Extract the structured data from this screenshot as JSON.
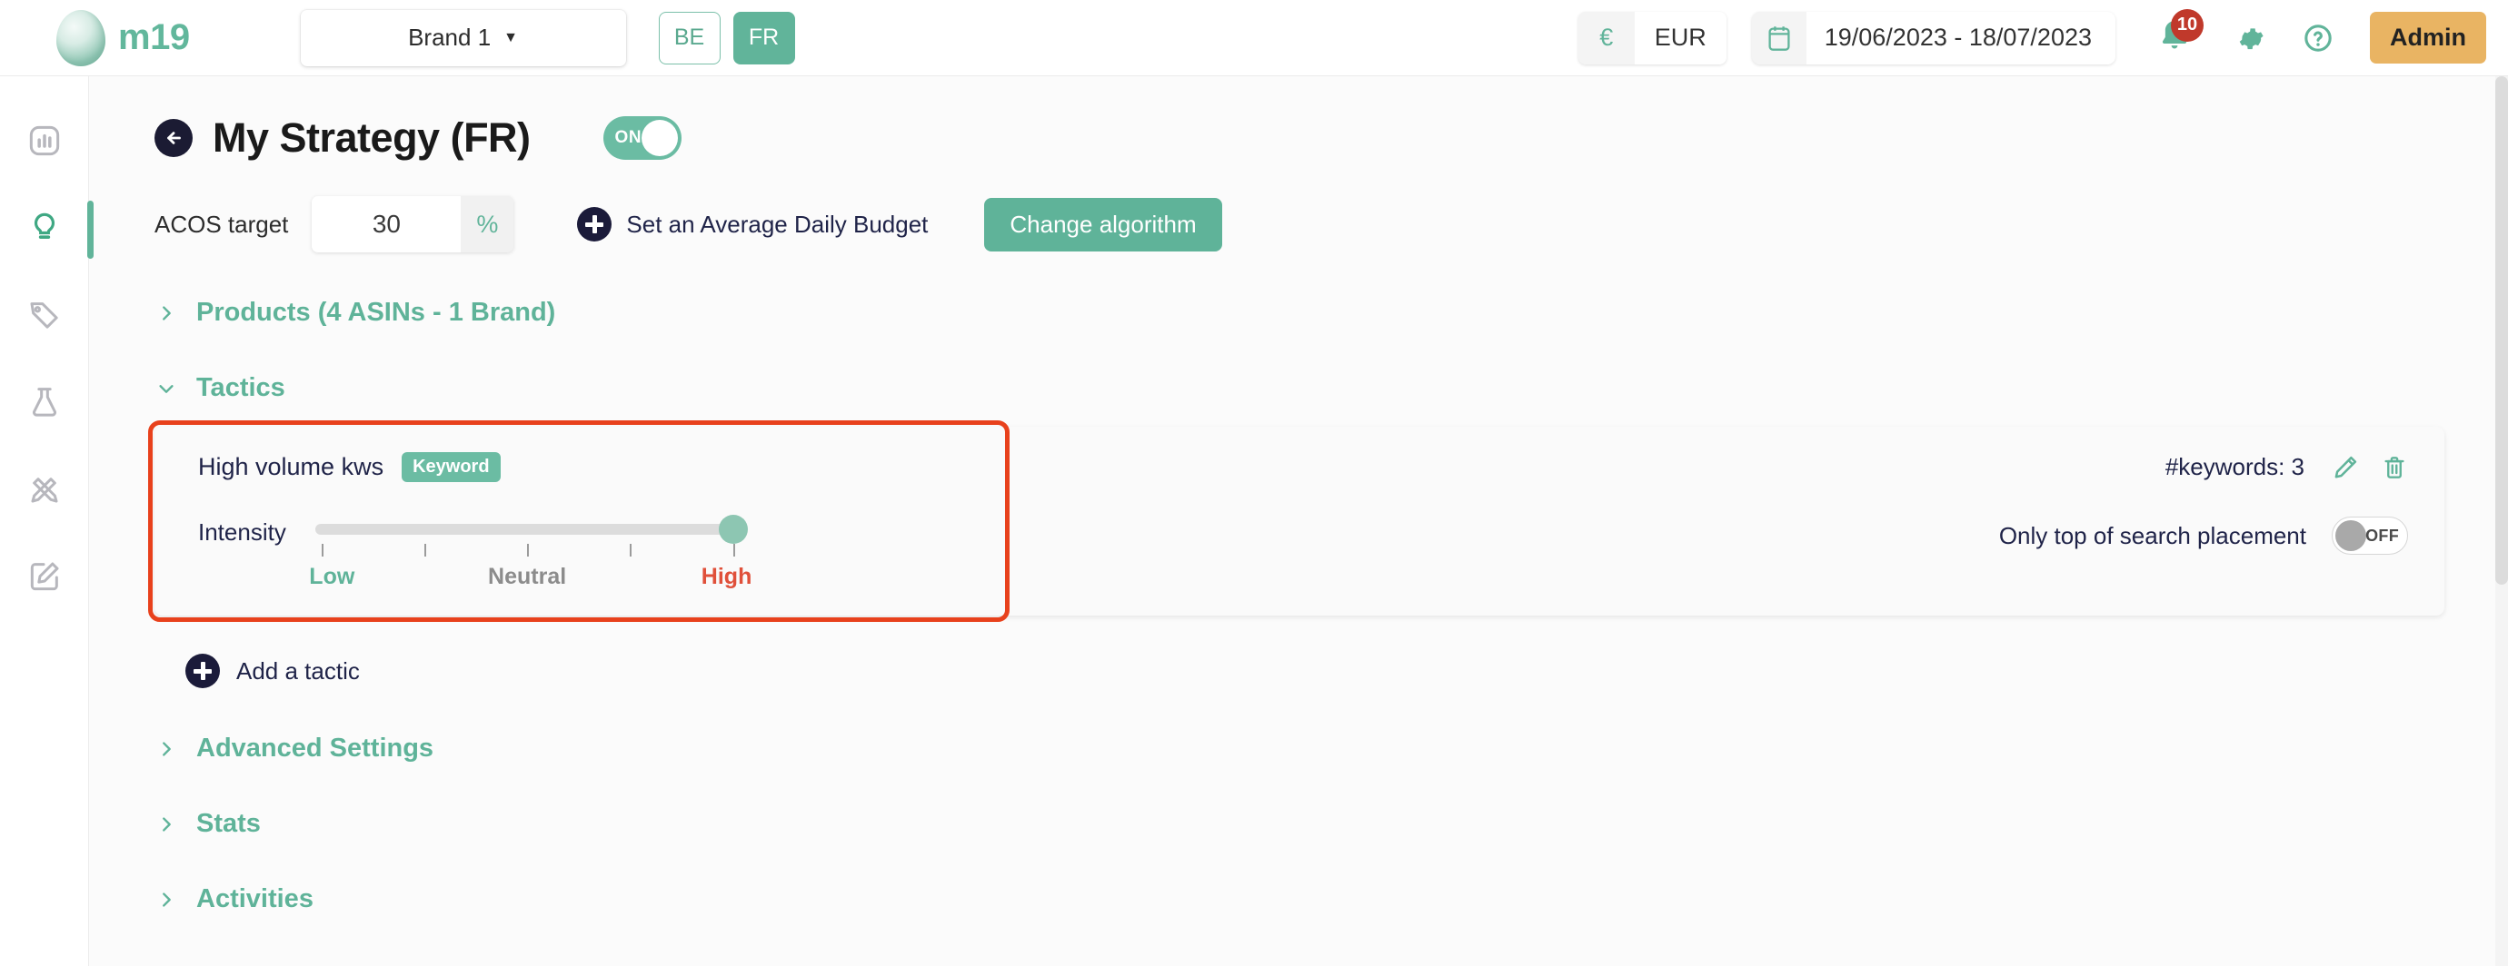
{
  "header": {
    "logo_text": "m19",
    "brand_selector": {
      "value": "Brand 1",
      "caret_icon": "chevron-down-icon"
    },
    "locales": [
      {
        "code": "BE",
        "active": false
      },
      {
        "code": "FR",
        "active": true
      }
    ],
    "currency": {
      "symbol": "€",
      "code": "EUR"
    },
    "date_range": "19/06/2023 - 18/07/2023",
    "notifications_count": "10",
    "admin_label": "Admin",
    "icons": {
      "calendar": "calendar-icon",
      "bell": "bell-icon",
      "gear": "gear-icon",
      "help": "question-circle-icon"
    }
  },
  "sidebar": {
    "items": [
      {
        "icon": "bar-chart-icon",
        "name": "dashboard",
        "active": false
      },
      {
        "icon": "lightbulb-icon",
        "name": "strategies",
        "active": true
      },
      {
        "icon": "tag-icon",
        "name": "products",
        "active": false
      },
      {
        "icon": "flask-icon",
        "name": "experiments",
        "active": false
      },
      {
        "icon": "pencil-ruler-icon",
        "name": "creative",
        "active": false
      },
      {
        "icon": "edit-square-icon",
        "name": "editor",
        "active": false
      }
    ]
  },
  "page": {
    "back_icon": "arrow-left-circle-icon",
    "title": "My Strategy (FR)",
    "status_toggle": {
      "label": "ON",
      "on": true
    },
    "acos": {
      "label": "ACOS target",
      "value": "30",
      "unit": "%"
    },
    "budget_link": {
      "icon": "plus-circle-icon",
      "label": "Set an Average Daily Budget"
    },
    "change_algorithm_label": "Change algorithm"
  },
  "sections": {
    "products": {
      "label": "Products (4 ASINs - 1 Brand)",
      "expanded": false,
      "chevron": "chevron-right-icon"
    },
    "tactics": {
      "label": "Tactics",
      "expanded": true,
      "chevron": "chevron-down-icon"
    },
    "advanced": {
      "label": "Advanced Settings",
      "expanded": false,
      "chevron": "chevron-right-icon"
    },
    "stats": {
      "label": "Stats",
      "expanded": false,
      "chevron": "chevron-right-icon"
    },
    "activities": {
      "label": "Activities",
      "expanded": false,
      "chevron": "chevron-right-icon"
    }
  },
  "tactic": {
    "name": "High volume kws",
    "type_chip": "Keyword",
    "keywords_count_label": "#keywords: 3",
    "edit_icon": "pencil-icon",
    "delete_icon": "trash-icon",
    "intensity": {
      "label": "Intensity",
      "ticks": 5,
      "value_position_pct": 100,
      "scale_labels": [
        {
          "text": "Low",
          "pos_pct": 3,
          "color": "#5fb399"
        },
        {
          "text": "Neutral",
          "pos_pct": 30,
          "color": "#8c8c8c"
        },
        {
          "text": "High",
          "pos_pct": 57,
          "color": "#e0503a"
        }
      ]
    },
    "placement": {
      "label": "Only top of search placement",
      "toggle_label": "OFF",
      "on": false
    }
  },
  "add_tactic": {
    "icon": "plus-circle-icon",
    "label": "Add a tactic"
  },
  "colors": {
    "accent_teal": "#61b49a",
    "navy": "#1f2348",
    "highlight_red": "#e8411c",
    "admin_amber": "#e9b463",
    "badge_red": "#c0392b"
  }
}
